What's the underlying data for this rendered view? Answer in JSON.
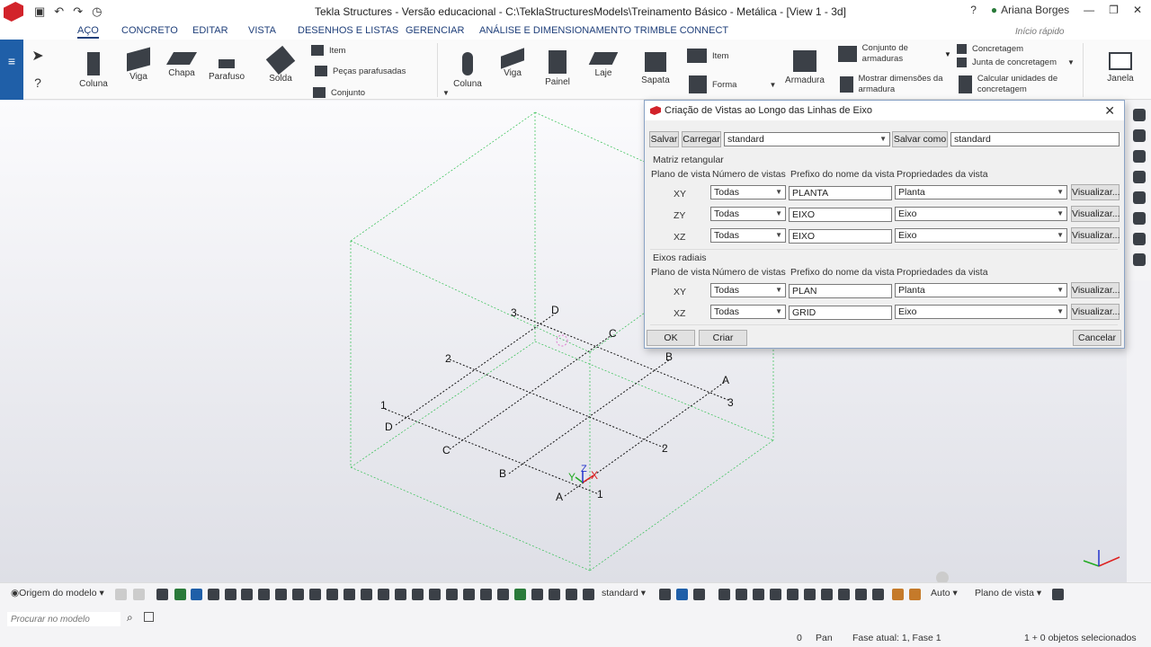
{
  "window": {
    "title": "Tekla Structures - Versão educacional - C:\\TeklaStructuresModels\\Treinamento Básico - Metálica - [View 1 - 3d]",
    "user": "Ariana Borges"
  },
  "tabs": [
    {
      "label": "AÇO"
    },
    {
      "label": "CONCRETO"
    },
    {
      "label": "EDITAR"
    },
    {
      "label": "VISTA"
    },
    {
      "label": "DESENHOS E LISTAS"
    },
    {
      "label": "GERENCIAR"
    },
    {
      "label": "ANÁLISE E DIMENSIONAMENTO"
    },
    {
      "label": "TRIMBLE CONNECT"
    }
  ],
  "quick_search_placeholder": "Início rápido",
  "ribbon": {
    "steel": {
      "coluna": "Coluna",
      "viga": "Viga",
      "chapa": "Chapa",
      "parafuso": "Parafuso",
      "solda": "Solda",
      "item": "Item",
      "pecas_parafusadas": "Peças parafusadas",
      "conjunto": "Conjunto"
    },
    "concrete": {
      "coluna": "Coluna",
      "viga": "Viga",
      "painel": "Painel",
      "laje": "Laje",
      "sapata": "Sapata",
      "item": "Item",
      "forma": "Forma",
      "armadura": "Armadura",
      "conjunto_armaduras": "Conjunto de armaduras",
      "mostrar_dimensoes": "Mostrar dimensões da armadura",
      "concretagem": "Concretagem",
      "junta_concretagem": "Junta de concretagem",
      "calcular_unidades": "Calcular unidades de concretagem",
      "janela": "Janela"
    }
  },
  "dialog": {
    "title": "Criação de Vistas ao Longo das Linhas de Eixo",
    "save": "Salvar",
    "load": "Carregar",
    "load_value": "standard",
    "save_as": "Salvar como",
    "save_as_value": "standard",
    "section_rect": "Matriz retangular",
    "section_radial": "Eixos radiais",
    "col_plane": "Plano de vista",
    "col_count": "Número de vistas",
    "col_prefix": "Prefixo do nome da vista",
    "col_props": "Propriedades da vista",
    "view_button": "Visualizar...",
    "rect_rows": [
      {
        "plane": "XY",
        "count": "Todas",
        "prefix": "PLANTA",
        "props": "Planta"
      },
      {
        "plane": "ZY",
        "count": "Todas",
        "prefix": "EIXO",
        "props": "Eixo"
      },
      {
        "plane": "XZ",
        "count": "Todas",
        "prefix": "EIXO",
        "props": "Eixo"
      }
    ],
    "radial_rows": [
      {
        "plane": "XY",
        "count": "Todas",
        "prefix": "PLAN",
        "props": "Planta"
      },
      {
        "plane": "XZ",
        "count": "Todas",
        "prefix": "GRID",
        "props": "Eixo"
      }
    ],
    "ok": "OK",
    "create": "Criar",
    "cancel": "Cancelar"
  },
  "grid_labels": {
    "letters": [
      "A",
      "B",
      "C",
      "D"
    ],
    "numbers": [
      "1",
      "2",
      "3"
    ]
  },
  "axes": {
    "x": "X",
    "y": "Y",
    "z": "Z"
  },
  "bottom": {
    "origin": "Origem do modelo",
    "standard": "standard",
    "auto": "Auto",
    "view_plane": "Plano de vista",
    "search_placeholder": "Procurar no modelo"
  },
  "status": {
    "zero": "0",
    "pan": "Pan",
    "phase": "Fase atual: 1, Fase 1",
    "selected": "1 + 0 objetos selecionados"
  }
}
